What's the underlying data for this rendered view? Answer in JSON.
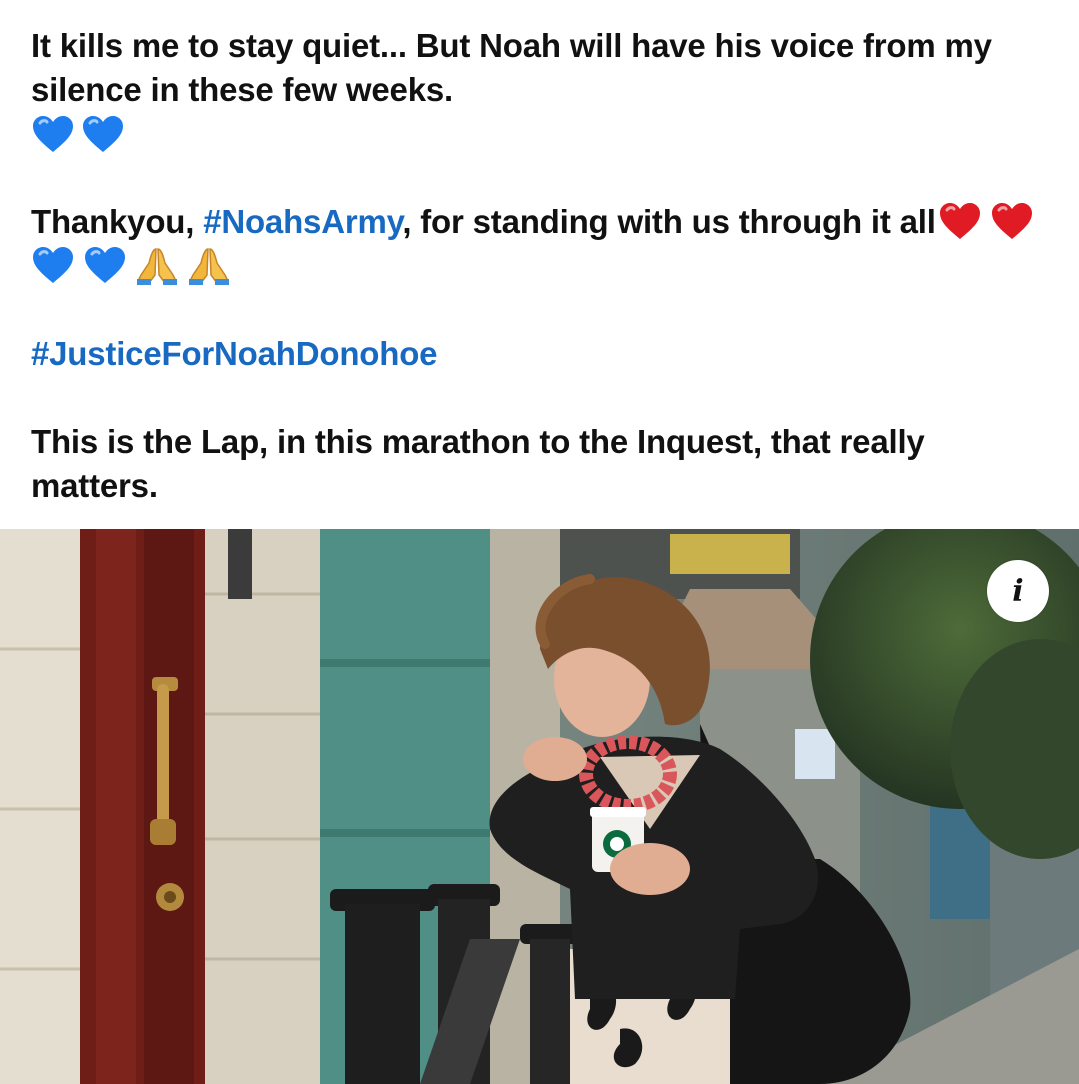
{
  "post": {
    "line1": "It kills me to stay quiet... But Noah will have his voice from my silence in these few weeks.",
    "thanks_prefix": "Thankyou, ",
    "thanks_hashtag": "#NoahsArmy",
    "thanks_suffix": ", for standing with us through it all",
    "hashtag_justice": "#JusticeForNoahDonohoe",
    "closing": "This is the Lap, in this marathon to the Inquest, that really matters."
  },
  "emojis": {
    "after_line1": [
      "blue-heart",
      "blue-heart"
    ],
    "after_thanks": [
      "red-heart",
      "red-heart",
      "blue-heart",
      "blue-heart",
      "folded-hands",
      "folded-hands"
    ]
  },
  "colors": {
    "text": "#111111",
    "hashtag": "#1769c2",
    "blue_heart": "#1e7ef0",
    "red_heart": "#e11b24"
  },
  "photo": {
    "info_icon": "i",
    "cup_brand": "starbucks-logo"
  }
}
